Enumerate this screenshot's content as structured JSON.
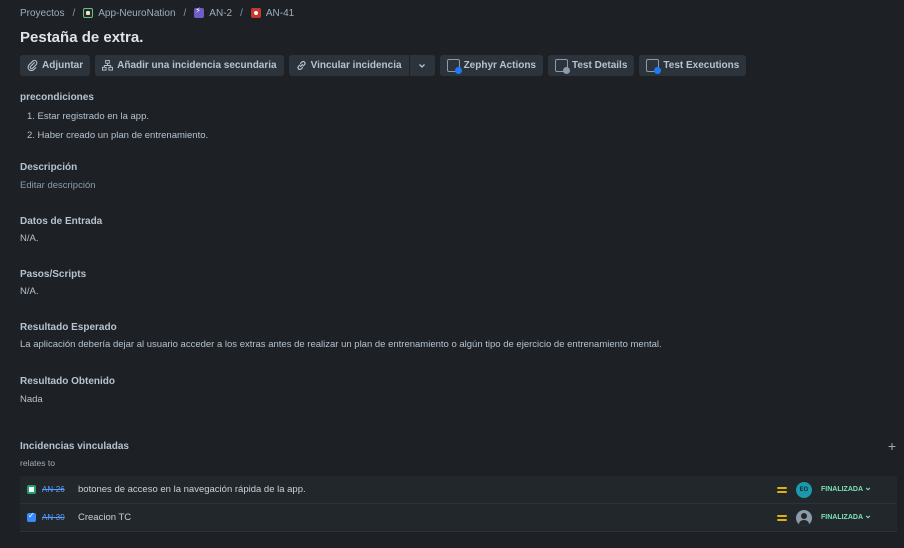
{
  "breadcrumb": {
    "root": "Proyectos",
    "project": "App-NeuroNation",
    "epic": "AN-2",
    "issue": "AN-41"
  },
  "issue": {
    "title": "Pestaña de extra."
  },
  "toolbar": {
    "attach": "Adjuntar",
    "add_child": "Añadir una incidencia secundaria",
    "link_issue": "Vincular incidencia",
    "zephyr_actions": "Zephyr Actions",
    "test_details": "Test Details",
    "test_executions": "Test Executions"
  },
  "fields": {
    "preconditions": {
      "label": "precondiciones",
      "items": [
        "1. Estar registrado en la app.",
        "2. Haber creado un plan de entrenamiento."
      ]
    },
    "description": {
      "label": "Descripción",
      "placeholder": "Editar descripción"
    },
    "input_data": {
      "label": "Datos de Entrada",
      "value": "N/A."
    },
    "steps": {
      "label": "Pasos/Scripts",
      "value": "N/A."
    },
    "expected": {
      "label": "Resultado Esperado",
      "value": "La aplicación debería dejar al usuario acceder a los extras antes de realizar un plan de entrenamiento o algún tipo de ejercicio de entrenamiento mental."
    },
    "actual": {
      "label": "Resultado Obtenido",
      "value": "Nada"
    }
  },
  "linked": {
    "label": "Incidencias vinculadas",
    "add_icon": "plus-icon",
    "relation": "relates to",
    "items": [
      {
        "type": "story",
        "key": "AN-26",
        "summary": "botones de acceso en la navegación rápida de la app.",
        "priority": "medium",
        "assignee": "EG",
        "status": "FINALIZADA"
      },
      {
        "type": "task",
        "key": "AN-30",
        "summary": "Creacion TC",
        "priority": "medium",
        "assignee": "",
        "status": "FINALIZADA"
      }
    ]
  },
  "colors": {
    "background": "#1d2125",
    "link": "#579dff",
    "done": "#7ee2b8",
    "priority_medium": "#e2b203"
  }
}
